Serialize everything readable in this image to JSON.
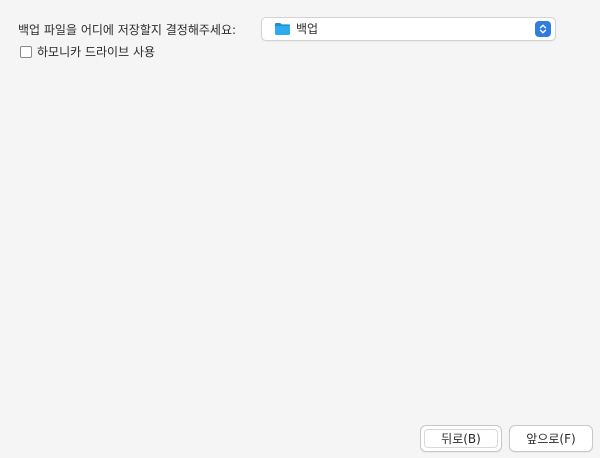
{
  "location": {
    "label": "백업 파일을 어디에 저장할지 결정해주세요:",
    "selected_folder": "백업",
    "folder_icon": "folder-icon",
    "folder_icon_color": "#29a3e6",
    "stepper_color": "#2f7de1"
  },
  "harmonica": {
    "label": "하모니카 드라이브 사용",
    "checked": false
  },
  "buttons": {
    "back_label": "뒤로(B)",
    "next_label": "앞으로(F)"
  }
}
